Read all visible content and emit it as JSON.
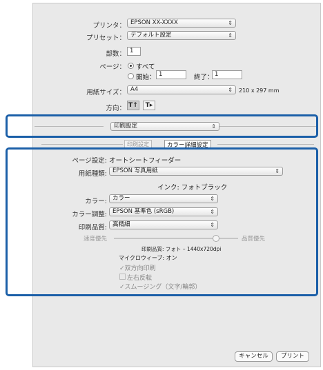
{
  "printer": {
    "label": "プリンタ：",
    "value": "EPSON XX-XXXX"
  },
  "preset": {
    "label": "プリセット：",
    "value": "デフォルト設定"
  },
  "copies": {
    "label": "部数：",
    "value": "1"
  },
  "pages": {
    "label": "ページ：",
    "all": "すべて",
    "from": "開始：",
    "from_value": "1",
    "to": "終了：",
    "to_value": "1"
  },
  "paper_size": {
    "label": "用紙サイズ：",
    "value": "A4",
    "dims": "210 x 297 mm"
  },
  "orientation": {
    "label": "方向：",
    "portrait": "T↑",
    "landscape": "T▸"
  },
  "panel_menu": {
    "value": "印刷設定"
  },
  "section_tabs": {
    "left": "印刷設定",
    "right": "カラー詳細設定"
  },
  "page_setup": {
    "label": "ページ設定:",
    "value": "オートシートフィーダー"
  },
  "media_type": {
    "label": "用紙種類:",
    "value": "EPSON 写真用紙"
  },
  "ink": {
    "value": "インク: フォトブラック"
  },
  "color": {
    "label": "カラー:",
    "value": "カラー"
  },
  "color_adjust": {
    "label": "カラー調整:",
    "value": "EPSON 基準色 (sRGB)"
  },
  "print_quality": {
    "label": "印刷品質:",
    "value": "高精細"
  },
  "speed_quality": {
    "left": "速度優先",
    "right": "品質優先",
    "level": 0.82
  },
  "quality_info": {
    "line1": "印刷品質: フォト – 1440x720dpi",
    "line2": "マイクロウィーブ: オン"
  },
  "options": {
    "bidirectional": "双方向印刷",
    "mirror": "左右反転",
    "smoothing": "スムージング（文字/輪郭）"
  },
  "buttons": {
    "cancel": "キャンセル",
    "print": "プリント"
  },
  "colors": {
    "highlight": "#1b5fa8",
    "dialog_bg": "#e9e9e9"
  }
}
